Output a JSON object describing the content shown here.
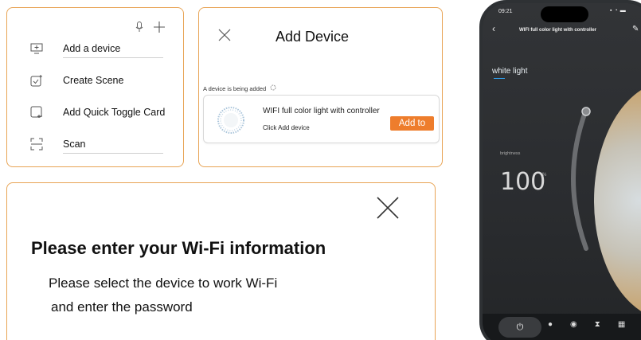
{
  "menu": {
    "items": [
      {
        "label": "Add a device",
        "icon": "add-device-icon"
      },
      {
        "label": "Create Scene",
        "icon": "create-scene-icon"
      },
      {
        "label": "Add Quick Toggle Card",
        "icon": "quick-toggle-icon"
      },
      {
        "label": "Scan",
        "icon": "scan-icon"
      }
    ],
    "top_icons": [
      "microphone-icon",
      "plus-icon"
    ]
  },
  "add_device": {
    "title": "Add Device",
    "status": "A device is being added",
    "device_name": "WIFI full color light with controller",
    "device_sub": "Click Add device",
    "add_button": "Add to"
  },
  "wifi_info": {
    "headline": "Please enter your Wi-Fi information",
    "line1": "Please select the device to work Wi-Fi",
    "line2": "and enter the password"
  },
  "phone": {
    "time": "09:21",
    "title": "WIFI full color light with controller",
    "mode_label": "white light",
    "brightness_label": "brightness",
    "brightness_value": "100",
    "brightness_unit": "%",
    "colors": {
      "accent": "#2fa1f0",
      "add_button": "#ee7d2c",
      "border": "#e8a455"
    }
  }
}
